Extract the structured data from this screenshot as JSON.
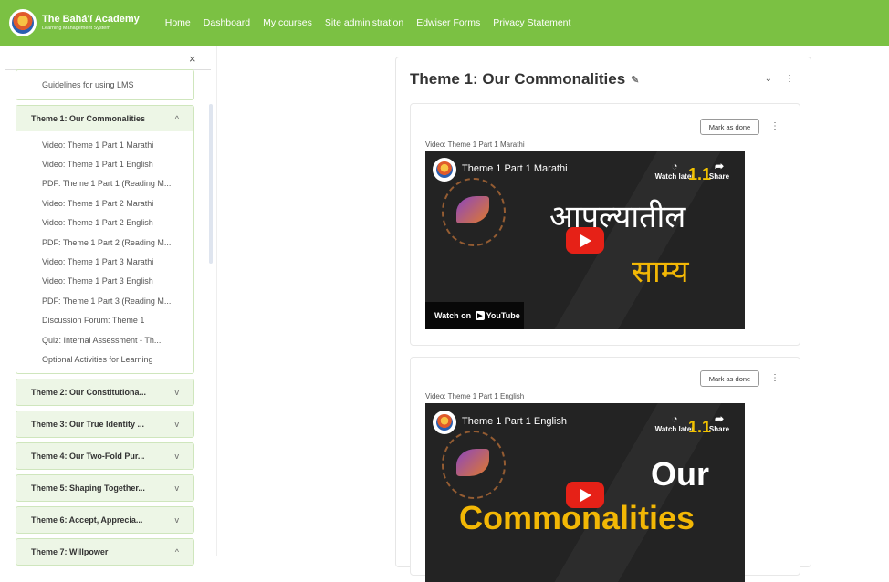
{
  "navbar": {
    "brand_title": "The Bahá'í Academy",
    "brand_subtitle": "Learning Management System",
    "links": [
      "Home",
      "Dashboard",
      "My courses",
      "Site administration",
      "Edwiser Forms",
      "Privacy Statement"
    ],
    "color": "#7bc143"
  },
  "drawer": {
    "close_icon": "×",
    "top_item": "Guidelines for using LMS",
    "expanded_section": {
      "title": "Theme 1: Our Commonalities",
      "chevron": "^",
      "items": [
        "Video: Theme 1 Part 1 Marathi",
        "Video: Theme 1 Part 1 English",
        "PDF: Theme 1 Part 1 (Reading M...",
        "Video: Theme 1 Part 2 Marathi",
        "Video: Theme 1 Part 2 English",
        "PDF: Theme 1 Part 2 (Reading M...",
        "Video: Theme 1 Part 3 Marathi",
        "Video: Theme 1 Part 3 English",
        "PDF: Theme 1 Part 3 (Reading M...",
        "Discussion Forum: Theme 1",
        "Quiz: Internal Assessment - Th...",
        "Optional Activities for Learning"
      ]
    },
    "collapsed_sections": [
      {
        "title": "Theme 2: Our Constitutiona...",
        "chevron": "v"
      },
      {
        "title": "Theme 3: Our True Identity ...",
        "chevron": "v"
      },
      {
        "title": "Theme 4: Our Two-Fold Pur...",
        "chevron": "v"
      },
      {
        "title": "Theme 5: Shaping Together...",
        "chevron": "v"
      },
      {
        "title": "Theme 6: Accept, Apprecia...",
        "chevron": "v"
      },
      {
        "title": "Theme 7: Willpower",
        "chevron": "^"
      }
    ]
  },
  "main": {
    "title": "Theme 1: Our Commonalities",
    "pencil_icon": "✎",
    "collapse_icon": "⌄",
    "menu_icon": "⋮",
    "activities": [
      {
        "mark_label": "Mark as done",
        "dots": "⋮",
        "label": "Video: Theme 1 Part 1 Marathi",
        "video_title": "Theme 1 Part 1 Marathi",
        "watch_later": "Watch later",
        "share": "Share",
        "badge": "1.1",
        "big_text_1": "आपल्यातील",
        "big_text_2": "साम्य",
        "watch_on": "Watch on",
        "yt_word": "YouTube"
      },
      {
        "mark_label": "Mark as done",
        "dots": "⋮",
        "label": "Video: Theme 1 Part 1 English",
        "video_title": "Theme 1 Part 1 English",
        "watch_later": "Watch later",
        "share": "Share",
        "badge": "1.1",
        "big_text_1": "Our",
        "big_text_2": "Commonalities"
      }
    ]
  }
}
